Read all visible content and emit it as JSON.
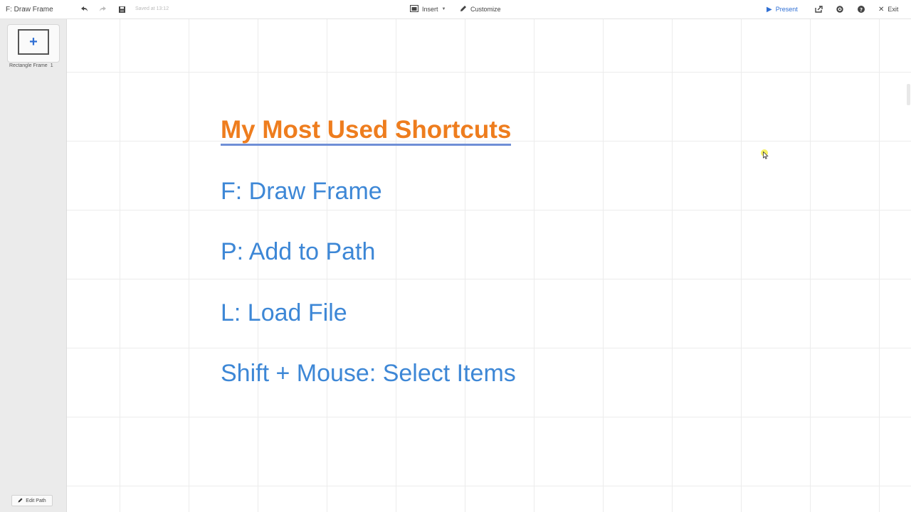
{
  "header": {
    "title": "F: Draw Frame",
    "saved_text": "Saved at 13:12",
    "insert_label": "Insert",
    "customize_label": "Customize",
    "present_label": "Present",
    "exit_label": "Exit"
  },
  "sidebar": {
    "frame_label": "Rectangle Frame",
    "frame_number": "1",
    "edit_path_label": "Edit Path"
  },
  "canvas": {
    "title": "My Most Used Shortcuts",
    "shortcuts": [
      "F: Draw Frame",
      "P: Add to Path",
      "L: Load File",
      "Shift + Mouse: Select Items"
    ]
  },
  "colors": {
    "title": "#ee7d1e",
    "title_underline": "#6f8fd6",
    "shortcut_text": "#3d87d6",
    "present_accent": "#2f6fd4"
  },
  "icons": [
    "undo-icon",
    "redo-icon",
    "save-icon",
    "insert-icon",
    "pencil-icon",
    "play-icon",
    "share-icon",
    "settings-icon",
    "help-icon",
    "close-icon",
    "plus-icon",
    "pen-icon"
  ]
}
